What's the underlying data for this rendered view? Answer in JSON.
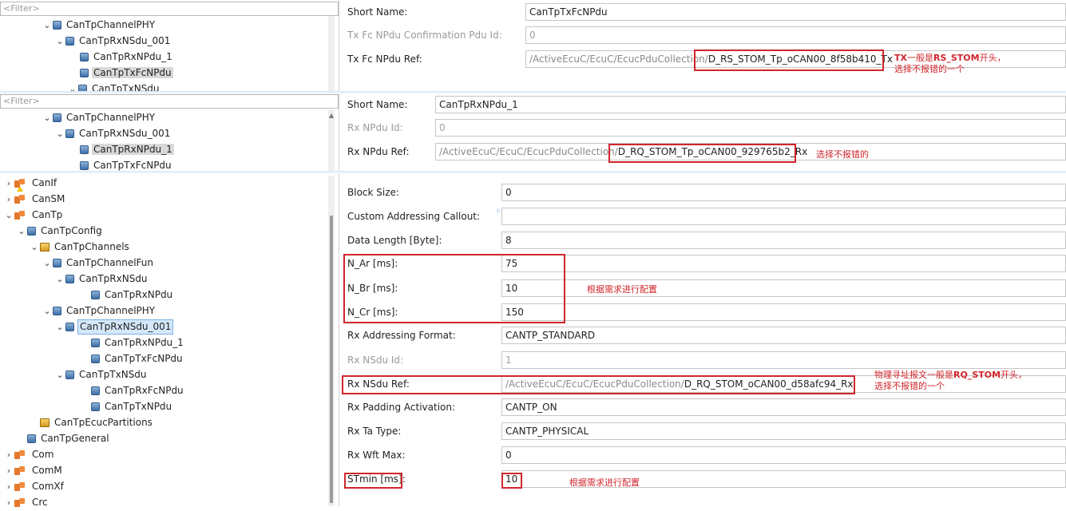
{
  "panel1": {
    "filter": "<Filter>",
    "tree": [
      "CanTpChannelPHY",
      "CanTpRxNSdu_001",
      "CanTpRxNPdu_1",
      "CanTpTxFcNPdu",
      "CanTpTxNSdu"
    ],
    "props": {
      "short_name_label": "Short Name:",
      "short_name_value": "CanTpTxFcNPdu",
      "confirm_label": "Tx Fc NPdu Confirmation Pdu Id:",
      "confirm_value": "0",
      "ref_label": "Tx Fc NPdu Ref:",
      "ref_path": "/ActiveEcuC/EcuC/EcucPduCollection/",
      "ref_value": "D_RS_STOM_Tp_oCAN00_8f58b410_Tx"
    },
    "note_line1_a": "TX",
    "note_line1_b": "一般是",
    "note_line1_c": "RS_STOM",
    "note_line1_d": "开头，",
    "note_line2": "选择不报错的一个"
  },
  "panel2": {
    "filter": "<Filter>",
    "tree": [
      "CanTpChannelPHY",
      "CanTpRxNSdu_001",
      "CanTpRxNPdu_1",
      "CanTpTxFcNPdu"
    ],
    "props": {
      "short_name_label": "Short Name:",
      "short_name_value": "CanTpRxNPdu_1",
      "id_label": "Rx NPdu Id:",
      "id_value": "0",
      "ref_label": "Rx NPdu Ref:",
      "ref_path": "/ActiveEcuC/EcuC/EcucPduCollection/",
      "ref_value": "D_RQ_STOM_Tp_oCAN00_929765b2_Rx"
    },
    "note": "选择不报错的"
  },
  "panel3": {
    "tree": [
      "CanIf",
      "CanSM",
      "CanTp",
      "CanTpConfig",
      "CanTpChannels",
      "CanTpChannelFun",
      "CanTpRxNSdu",
      "CanTpRxNPdu",
      "CanTpChannelPHY",
      "CanTpRxNSdu_001",
      "CanTpRxNPdu_1",
      "CanTpTxFcNPdu",
      "CanTpTxNSdu",
      "CanTpRxFcNPdu",
      "CanTpTxNPdu",
      "CanTpEcucPartitions",
      "CanTpGeneral",
      "Com",
      "ComM",
      "ComXf",
      "Crc"
    ],
    "props": [
      {
        "label": "Block Size:",
        "value": "0"
      },
      {
        "label": "Custom Addressing Callout:",
        "value": ""
      },
      {
        "label": "Data Length [Byte]:",
        "value": "8"
      },
      {
        "label": "N_Ar [ms]:",
        "value": "75"
      },
      {
        "label": "N_Br [ms]:",
        "value": "10"
      },
      {
        "label": "N_Cr [ms]:",
        "value": "150"
      },
      {
        "label": "Rx Addressing Format:",
        "value": "CANTP_STANDARD"
      },
      {
        "label": "Rx NSdu Id:",
        "value": "1"
      },
      {
        "label": "Rx NSdu Ref:",
        "value": "/ActiveEcuC/EcuC/EcucPduCollection/",
        "value2": "D_RQ_STOM_oCAN00_d58afc94_Rx"
      },
      {
        "label": "Rx Padding Activation:",
        "value": "CANTP_ON"
      },
      {
        "label": "Rx Ta Type:",
        "value": "CANTP_PHYSICAL"
      },
      {
        "label": "Rx Wft Max:",
        "value": "0"
      },
      {
        "label": "STmin [ms]:",
        "value": "10"
      }
    ],
    "note_config1": "根据需求进行配置",
    "note_ref_line1_a": "物理寻址报文一般是",
    "note_ref_line1_b": "RQ_STOM",
    "note_ref_line1_c": "开头，",
    "note_ref_line2": "选择不报错的一个",
    "note_config2": "根据需求进行配置"
  }
}
